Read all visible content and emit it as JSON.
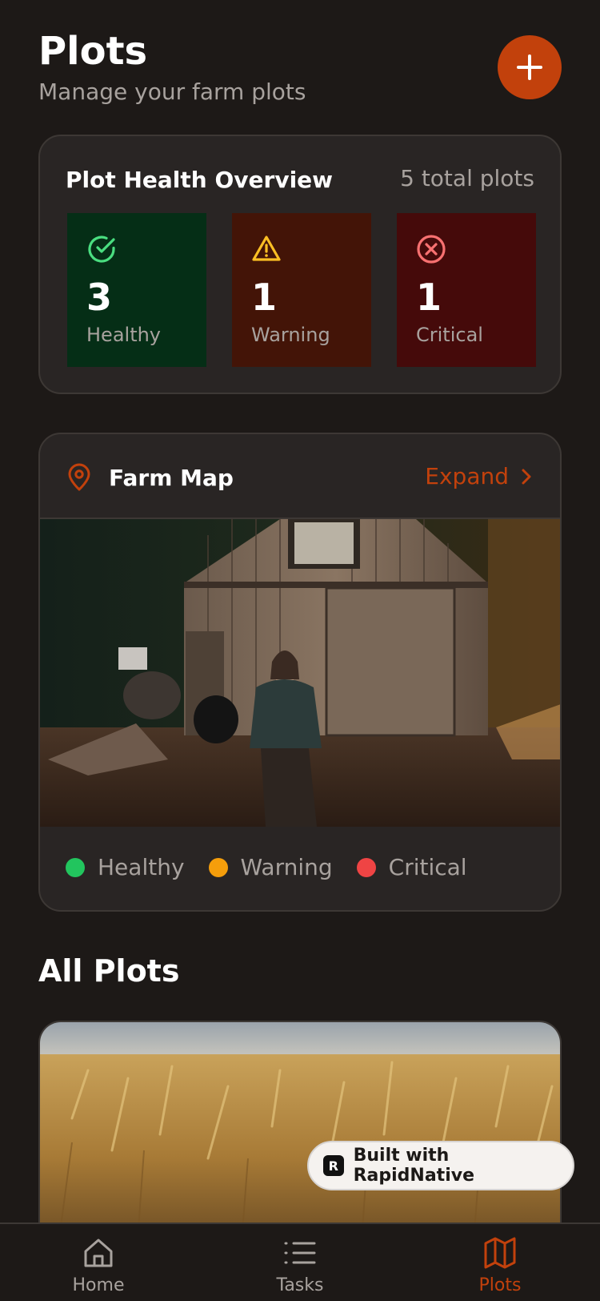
{
  "header": {
    "title": "Plots",
    "subtitle": "Manage your farm plots",
    "add_icon": "plus-icon"
  },
  "health": {
    "title": "Plot Health Overview",
    "total": "5 total plots",
    "stats": [
      {
        "count": "3",
        "label": "Healthy",
        "icon": "check-circle-icon",
        "color": "#4ade80"
      },
      {
        "count": "1",
        "label": "Warning",
        "icon": "alert-triangle-icon",
        "color": "#fbbf24"
      },
      {
        "count": "1",
        "label": "Critical",
        "icon": "x-circle-icon",
        "color": "#f87171"
      }
    ]
  },
  "farm_map": {
    "title": "Farm Map",
    "expand_label": "Expand",
    "legend": [
      {
        "label": "Healthy",
        "color": "#22c55e"
      },
      {
        "label": "Warning",
        "color": "#f59e0b"
      },
      {
        "label": "Critical",
        "color": "#ef4444"
      }
    ]
  },
  "all_plots": {
    "title": "All Plots"
  },
  "badge": {
    "label": "Built with RapidNative"
  },
  "nav": {
    "items": [
      {
        "label": "Home",
        "icon": "home-icon"
      },
      {
        "label": "Tasks",
        "icon": "list-icon"
      },
      {
        "label": "Plots",
        "icon": "map-icon",
        "active": true
      }
    ]
  },
  "colors": {
    "accent": "#c2410c",
    "background": "#1d1917",
    "card": "#292524"
  }
}
